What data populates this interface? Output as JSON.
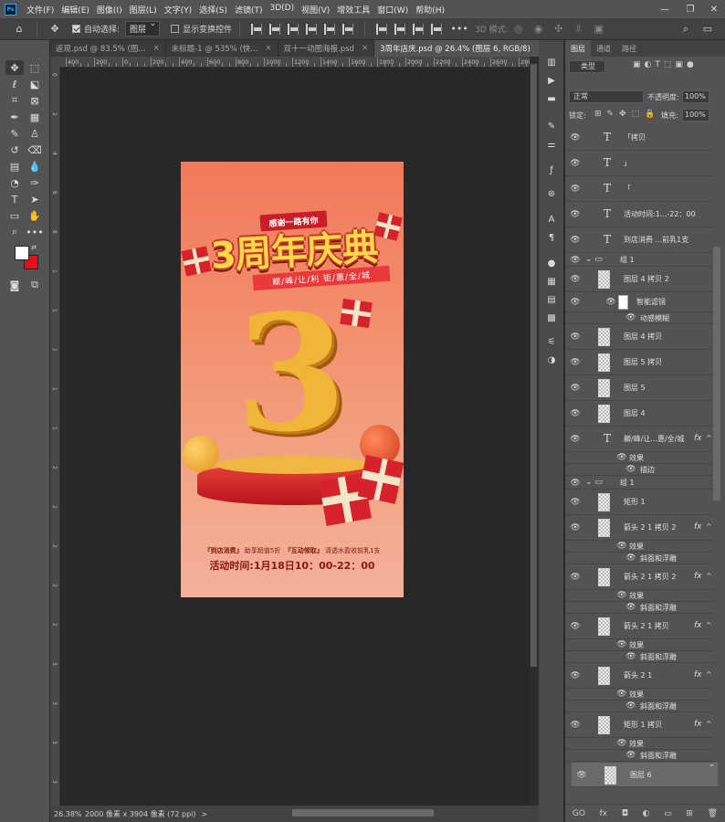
{
  "menu": {
    "logo": "Ps",
    "items": [
      "文件(F)",
      "编辑(E)",
      "图像(I)",
      "图层(L)",
      "文字(Y)",
      "选择(S)",
      "滤镜(T)",
      "3D(D)",
      "视图(V)",
      "增效工具",
      "窗口(W)",
      "帮助(H)"
    ]
  },
  "window_controls": {
    "minimize": "—",
    "maximize": "❐",
    "close": "✕"
  },
  "options": {
    "auto_select_label": "自动选择:",
    "auto_select_checked": true,
    "target_value": "图层",
    "show_transform_label": "显示变换控件",
    "mode_3d": "3D 模式:"
  },
  "tabs": [
    {
      "label": "返现.psd @ 83.5% (图...",
      "active": false
    },
    {
      "label": "未标题-1 @ 535% (快...",
      "active": false
    },
    {
      "label": "双十一动图海报.psd",
      "active": false
    },
    {
      "label": "3周年店庆.psd @ 26.4% (图层 6, RGB/8)",
      "active": true
    }
  ],
  "tab_close": "×",
  "ruler_h": [
    "400",
    "200",
    "0",
    "200",
    "400",
    "600",
    "800",
    "1000",
    "1200",
    "1400",
    "1600",
    "1800",
    "2000",
    "2200",
    "2400",
    "2600",
    "2800"
  ],
  "ruler_v": [
    "0",
    "2",
    "4",
    "6",
    "8",
    "1",
    "1",
    "1",
    "1",
    "1",
    "2",
    "2",
    "2",
    "2",
    "2",
    "3",
    "3",
    "3",
    "3"
  ],
  "poster": {
    "ribbon": "感谢一路有你",
    "title": "3周年庆典",
    "subtitle": "巅/峰/让/利 钜/惠/全/城",
    "big_number": "3",
    "promo_left_tag": "『到店消费』",
    "promo_left": "助享超值5折",
    "promo_right_tag": "『互动领取』",
    "promo_right": "清透水盈收前乳1支",
    "activity_time": "活动时间:1月18日10：00-22：00"
  },
  "status": {
    "zoom": "26.38%",
    "doc_info": "2000 像素 x 3904 像素 (72 ppi)",
    "arrow": ">"
  },
  "panel_tabs": [
    {
      "label": "图层",
      "active": true
    },
    {
      "label": "通道",
      "active": false
    },
    {
      "label": "路径",
      "active": false
    }
  ],
  "layer_filter": {
    "kind": "类型",
    "blend": "正常",
    "opacity_label": "不透明度:",
    "opacity": "100%",
    "lock_label": "锁定:",
    "fill_label": "填充:",
    "fill": "100%"
  },
  "layers": [
    {
      "name": "「拷贝",
      "kind": "text"
    },
    {
      "name": "」",
      "kind": "text"
    },
    {
      "name": "「",
      "kind": "text"
    },
    {
      "name": "活动时间:1...-22：00",
      "kind": "text"
    },
    {
      "name": "到店消费 ...前乳1支",
      "kind": "text"
    },
    {
      "name": "组 1",
      "kind": "group"
    },
    {
      "name": "图层 4 拷贝 2",
      "kind": "image"
    },
    {
      "name": "智能滤镜",
      "kind": "filter"
    },
    {
      "name": "动感模糊",
      "kind": "sub"
    },
    {
      "name": "图层 4 拷贝",
      "kind": "image"
    },
    {
      "name": "图层 5 拷贝",
      "kind": "image"
    },
    {
      "name": "图层 5",
      "kind": "image"
    },
    {
      "name": "图层 4",
      "kind": "image"
    },
    {
      "name": "巅/峰/让...惠/全/城",
      "kind": "text",
      "fx": "fx"
    },
    {
      "name": "效果",
      "kind": "effect"
    },
    {
      "name": "描边",
      "kind": "sub"
    },
    {
      "name": "组 1",
      "kind": "group"
    },
    {
      "name": "矩形 1",
      "kind": "image"
    },
    {
      "name": "箭头 2 1 拷贝 2",
      "kind": "image",
      "fx": "fx"
    },
    {
      "name": "效果",
      "kind": "effect"
    },
    {
      "name": "斜面和浮雕",
      "kind": "sub"
    },
    {
      "name": "箭头 2 1 拷贝 2",
      "kind": "image",
      "fx": "fx"
    },
    {
      "name": "效果",
      "kind": "effect"
    },
    {
      "name": "斜面和浮雕",
      "kind": "sub"
    },
    {
      "name": "箭头 2 1 拷贝",
      "kind": "image",
      "fx": "fx"
    },
    {
      "name": "效果",
      "kind": "effect"
    },
    {
      "name": "斜面和浮雕",
      "kind": "sub"
    },
    {
      "name": "箭头 2 1",
      "kind": "image",
      "fx": "fx"
    },
    {
      "name": "效果",
      "kind": "effect"
    },
    {
      "name": "斜面和浮雕",
      "kind": "sub"
    },
    {
      "name": "矩形 1 拷贝",
      "kind": "image",
      "fx": "fx"
    },
    {
      "name": "效果",
      "kind": "effect"
    },
    {
      "name": "斜面和浮雕",
      "kind": "sub"
    },
    {
      "name": "图层 6",
      "kind": "image",
      "selected": true
    }
  ],
  "panel_bottom": [
    "GO",
    "fx",
    "◘",
    "◐",
    "▭",
    "⊞",
    "🗑"
  ]
}
